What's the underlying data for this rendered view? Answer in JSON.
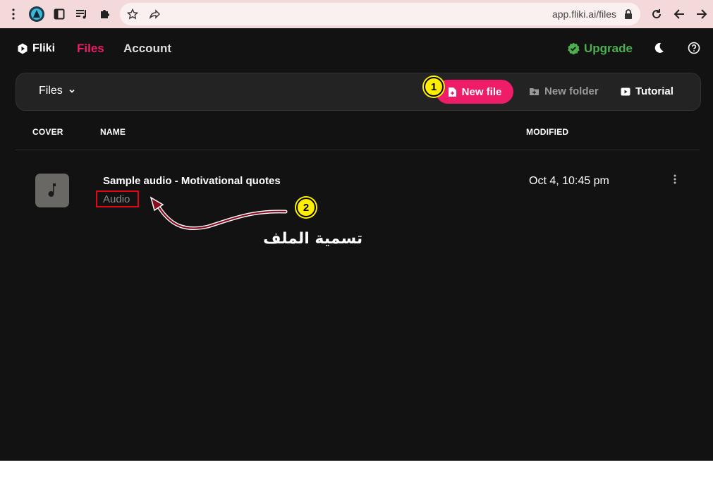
{
  "browser": {
    "url": "app.fliki.ai/files"
  },
  "nav": {
    "logo": "Fliki",
    "files": "Files",
    "account": "Account",
    "upgrade": "Upgrade"
  },
  "toolbar": {
    "folder_select": "Files",
    "new_file": "New file",
    "new_folder": "New folder",
    "tutorial": "Tutorial"
  },
  "table": {
    "headers": [
      "COVER",
      "NAME",
      "MODIFIED"
    ],
    "rows": [
      {
        "name": "Sample audio - Motivational quotes",
        "type": "Audio",
        "modified": "Oct 4, 10:45 pm"
      }
    ]
  },
  "annotations": {
    "step1": "1",
    "step2": "2",
    "caption": "تسمية الملف"
  },
  "colors": {
    "accent": "#ef1c69",
    "upgrade": "#4caf50",
    "highlight": "#e30613",
    "badge": "#ffee00"
  }
}
